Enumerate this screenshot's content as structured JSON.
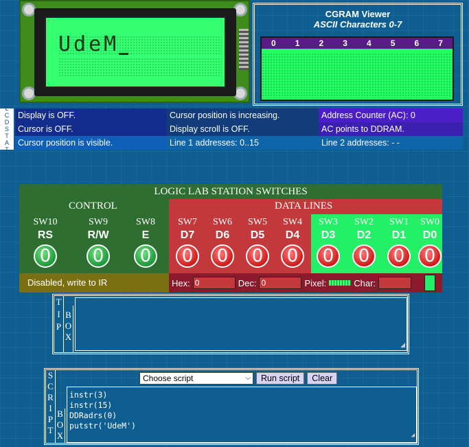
{
  "lcd": {
    "line1": "UdeM",
    "line2": ""
  },
  "cgram": {
    "title": "CGRAM Viewer",
    "subtitle": "ASCII Characters 0-7",
    "columns": [
      "0",
      "1",
      "2",
      "3",
      "4",
      "5",
      "6",
      "7"
    ]
  },
  "status_side": [
    "L",
    "C",
    "D",
    "S",
    "T",
    "A",
    "T"
  ],
  "status": [
    [
      "Display is  OFF.",
      "Cursor position is  increasing.",
      "Address Counter (AC):  0"
    ],
    [
      "Cursor is  OFF.",
      "Display scroll is  OFF.",
      "AC points to  DDRAM."
    ],
    [
      "Cursor position  is visible.",
      "Line 1 addresses:  0..15",
      "Line 2 addresses:  - -"
    ]
  ],
  "switches": {
    "title": "LOGIC LAB STATION SWITCHES",
    "control_label": "CONTROL",
    "data_label": "DATA LINES",
    "control": [
      {
        "name": "SW10",
        "signal": "RS",
        "value": "0"
      },
      {
        "name": "SW9",
        "signal": "R/W",
        "value": "0"
      },
      {
        "name": "SW8",
        "signal": "E",
        "value": "0"
      }
    ],
    "data": [
      {
        "name": "SW7",
        "signal": "D7",
        "value": "0"
      },
      {
        "name": "SW6",
        "signal": "D6",
        "value": "0"
      },
      {
        "name": "SW5",
        "signal": "D5",
        "value": "0"
      },
      {
        "name": "SW4",
        "signal": "D4",
        "value": "0"
      },
      {
        "name": "SW3",
        "signal": "D3",
        "value": "0"
      },
      {
        "name": "SW2",
        "signal": "D2",
        "value": "0"
      },
      {
        "name": "SW1",
        "signal": "D1",
        "value": "0"
      },
      {
        "name": "SW0",
        "signal": "D0",
        "value": "0"
      }
    ],
    "mode_text": "Disabled, write to IR",
    "hex_label": "Hex:",
    "hex_value": "0",
    "dec_label": "Dec:",
    "dec_value": "0",
    "pixel_label": "Pixel:",
    "char_label": "Char:",
    "char_value": ""
  },
  "tip": {
    "label": [
      "T",
      "I",
      "P",
      "B",
      "O",
      "X"
    ],
    "text": ""
  },
  "script": {
    "label": [
      "S",
      "C",
      "R",
      "I",
      "P",
      "T",
      "B",
      "O",
      "X"
    ],
    "select_value": "Choose script",
    "run_label": "Run script",
    "clear_label": "Clear",
    "lines": [
      "instr(3)",
      "instr(15)",
      "DDRadrs(0)",
      "putstr('UdeM')"
    ]
  },
  "colors": {
    "lcd_green": "#33ff70",
    "control_green": "#2f6e31",
    "data_red": "#c3393b"
  }
}
